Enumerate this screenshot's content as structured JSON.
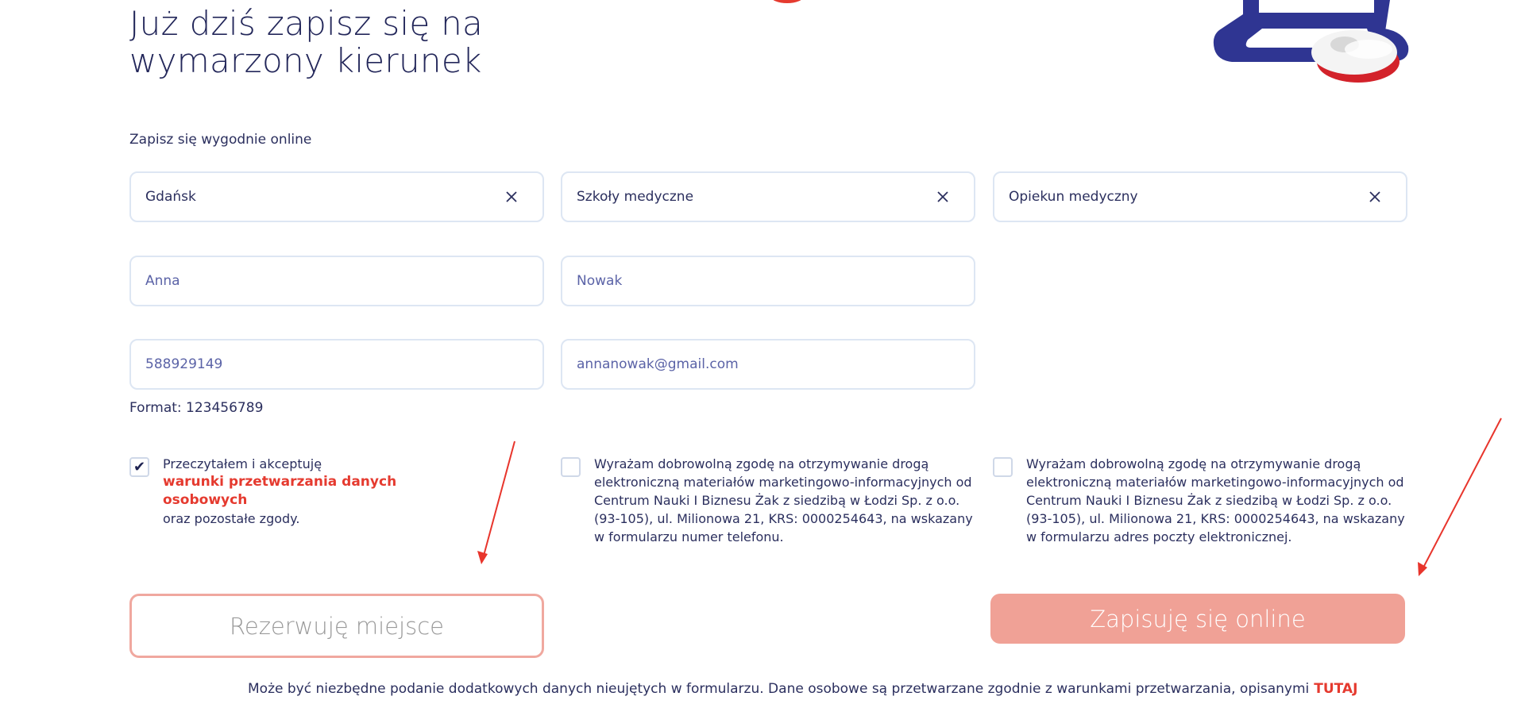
{
  "heading": "Już dziś zapisz się na wymarzony kierunek",
  "subtitle": "Zapisz się wygodnie online",
  "selects": {
    "city": "Gdańsk",
    "school_type": "Szkoły medyczne",
    "course": "Opiekun medyczny"
  },
  "inputs": {
    "first_name": "Anna",
    "last_name": "Nowak",
    "phone": "588929149",
    "email": "annanowak@gmail.com"
  },
  "phone_hint": "Format: 123456789",
  "consents": {
    "terms": {
      "checked": true,
      "line1": "Przeczytałem i akceptuję",
      "link": "warunki przetwarzania danych osobowych",
      "line2": "oraz pozostałe zgody."
    },
    "marketing_phone": {
      "checked": false,
      "text": "Wyrażam dobrowolną zgodę na otrzymywanie drogą elektroniczną materiałów marketingowo-informacyjnych od Centrum Nauki I Biznesu Żak z siedzibą w Łodzi Sp. z o.o. (93-105), ul. Milionowa 21, KRS: 0000254643, na wskazany w formularzu numer telefonu."
    },
    "marketing_email": {
      "checked": false,
      "text": "Wyrażam dobrowolną zgodę na otrzymywanie drogą elektroniczną materiałów marketingowo-informacyjnych od Centrum Nauki I Biznesu Żak z siedzibą w Łodzi Sp. z o.o. (93-105), ul. Milionowa 21, KRS: 0000254643, na wskazany w formularzu adres poczty elektronicznej."
    }
  },
  "buttons": {
    "reserve": "Rezerwuję miejsce",
    "signup": "Zapisuję się online"
  },
  "footer": {
    "text": "Może być niezbędne podanie dodatkowych danych nieujętych w formularzu. Dane osobowe są przetwarzane zgodnie z warunkami przetwarzania, opisanymi",
    "link": "TUTAJ"
  },
  "colors": {
    "navy": "#23275a",
    "accent_red": "#e53a2f",
    "button_fill": "#f0a196",
    "field_border": "#dde6f3"
  },
  "icons": {
    "clear": "close-icon",
    "check": "check-icon",
    "illustration": "computer-mouse-illustration",
    "annotation": "red-arrow"
  }
}
